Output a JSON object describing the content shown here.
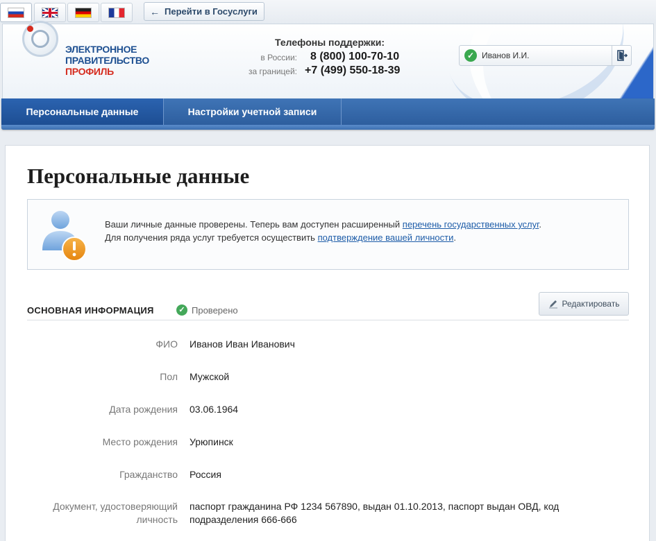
{
  "top": {
    "languages": [
      {
        "code": "ru",
        "icon": "flag-ru-icon",
        "active": true
      },
      {
        "code": "en",
        "icon": "flag-uk-icon",
        "active": false
      },
      {
        "code": "de",
        "icon": "flag-de-icon",
        "active": false
      },
      {
        "code": "fr",
        "icon": "flag-fr-icon",
        "active": false
      }
    ],
    "goto_button": {
      "arrow": "←",
      "label": "Перейти в Госуслуги",
      "icon": "arrow-left-icon"
    }
  },
  "header": {
    "logo": {
      "line1": "ЭЛЕКТРОННОЕ",
      "line2": "ПРАВИТЕЛЬСТВО",
      "line3": "ПРОФИЛЬ"
    },
    "support": {
      "title": "Телефоны поддержки:",
      "russia_label": "в России:",
      "russia_phone": "8 (800) 100-70-10",
      "abroad_label": "за границей:",
      "abroad_phone": "+7 (499) 550-18-39"
    },
    "user": {
      "name": "Иванов И.И.",
      "check_icon": "check-icon",
      "exit_icon": "logout-icon"
    }
  },
  "nav": {
    "tabs": [
      {
        "label": "Персональные данные",
        "active": true
      },
      {
        "label": "Настройки учетной записи",
        "active": false
      }
    ]
  },
  "main": {
    "title": "Персональные данные",
    "notice": {
      "icon": "user-warning-icon",
      "line1_text": "Ваши личные данные проверены. Теперь вам доступен расширенный ",
      "line1_link": "перечень государственных услуг",
      "line1_end": ".",
      "line2_text": "Для получения ряда услуг требуется осуществить ",
      "line2_link": "подтверждение вашей личности",
      "line2_end": "."
    },
    "section": {
      "title": "ОСНОВНАЯ ИНФОРМАЦИЯ",
      "status": "Проверено",
      "edit_label": "Редактировать"
    },
    "fields": [
      {
        "label": "ФИО",
        "value": "Иванов Иван Иванович"
      },
      {
        "label": "Пол",
        "value": "Мужской"
      },
      {
        "label": "Дата рождения",
        "value": "03.06.1964"
      },
      {
        "label": "Место рождения",
        "value": "Урюпинск"
      },
      {
        "label": "Гражданство",
        "value": "Россия"
      },
      {
        "label": "Документ, удостоверяющий личность",
        "value": "паспорт гражданина РФ 1234 567890, выдан 01.10.2013, паспорт выдан ОВД, код подразделения 666-666"
      }
    ]
  },
  "colors": {
    "brand_blue": "#2a5a9a",
    "link": "#1d5ca8",
    "accent_red": "#d52b1e",
    "success": "#44a85a",
    "warning": "#f29a1f"
  }
}
